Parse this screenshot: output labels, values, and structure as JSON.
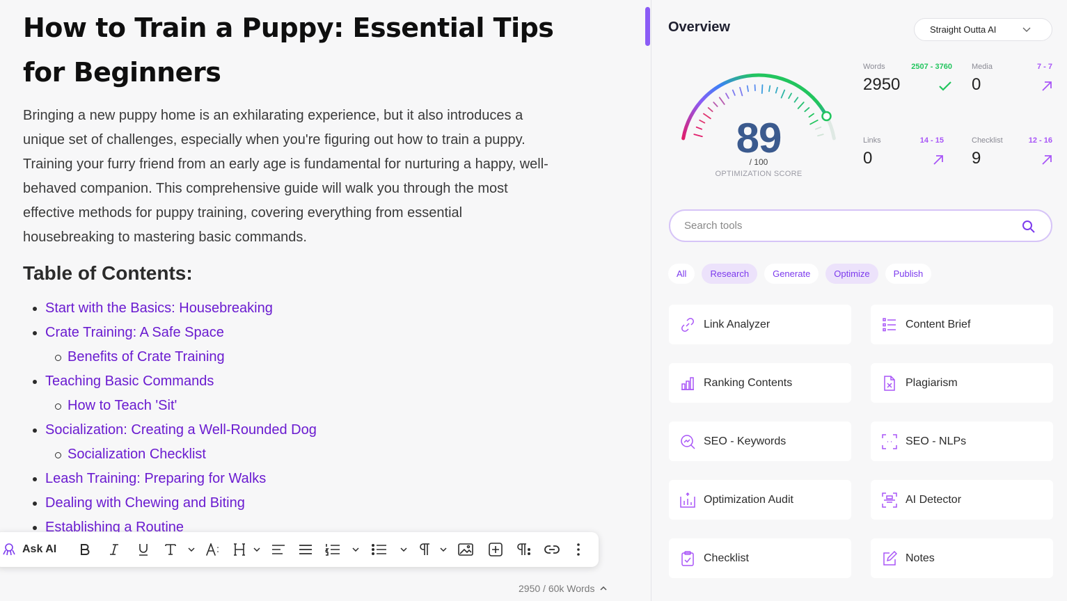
{
  "document": {
    "title": "How to Train a Puppy: Essential Tips for Beginners",
    "intro": "Bringing a new puppy home is an exhilarating experience, but it also introduces a unique set of challenges, especially when you're figuring out how to train a puppy. Training your furry friend from an early age is fundamental for nurturing a happy, well-behaved companion. This comprehensive guide will walk you through the most effective methods for puppy training, covering everything from essential housebreaking to mastering basic commands.",
    "toc_heading": "Table of Contents:",
    "toc": [
      {
        "label": "Start with the Basics: Housebreaking",
        "level": 1
      },
      {
        "label": "Crate Training: A Safe Space",
        "level": 1
      },
      {
        "label": "Benefits of Crate Training",
        "level": 2
      },
      {
        "label": "Teaching Basic Commands",
        "level": 1
      },
      {
        "label": "How to Teach 'Sit'",
        "level": 2
      },
      {
        "label": "Socialization: Creating a Well-Rounded Dog",
        "level": 1
      },
      {
        "label": "Socialization Checklist",
        "level": 2
      },
      {
        "label": "Leash Training: Preparing for Walks",
        "level": 1
      },
      {
        "label": "Dealing with Chewing and Biting",
        "level": 1
      },
      {
        "label": "Establishing a Routine",
        "level": 1
      }
    ],
    "link_color": "#6a1bd0"
  },
  "toolbar": {
    "ask_ai_label": "Ask AI",
    "icons": [
      "octopus-icon",
      "bold-icon",
      "italic-icon",
      "underline-icon",
      "text-style-icon",
      "font-size-icon",
      "heading-icon",
      "align-left-icon",
      "justify-icon",
      "ordered-list-icon",
      "bullet-list-icon",
      "paragraph-icon",
      "image-icon",
      "add-block-icon",
      "show-formatting-icon",
      "link-icon",
      "more-icon"
    ]
  },
  "word_count": "2950 / 60k Words",
  "overview": {
    "title": "Overview",
    "mode_select": "Straight Outta AI",
    "score": "89",
    "score_max": "/ 100",
    "score_label": "OPTIMIZATION SCORE",
    "score_fraction": 0.89,
    "stats": {
      "words": {
        "name": "Words",
        "range": "2507 - 3760",
        "value": "2950",
        "status": "check-icon"
      },
      "media": {
        "name": "Media",
        "range": "7 - 7",
        "value": "0",
        "status": "arrow-up-right-icon"
      },
      "links": {
        "name": "Links",
        "range": "14 - 15",
        "value": "0",
        "status": "arrow-up-right-icon"
      },
      "checklist": {
        "name": "Checklist",
        "range": "12 - 16",
        "value": "9",
        "status": "arrow-up-right-icon"
      }
    },
    "colors": {
      "ok": "#22c55e",
      "needs_work": "#a855f7",
      "accent": "#7c3aed"
    }
  },
  "search": {
    "placeholder": "Search tools"
  },
  "filters": [
    {
      "label": "All",
      "active": false
    },
    {
      "label": "Research",
      "active": true
    },
    {
      "label": "Generate",
      "active": false
    },
    {
      "label": "Optimize",
      "active": true
    },
    {
      "label": "Publish",
      "active": false
    }
  ],
  "tools": [
    {
      "label": "Link Analyzer",
      "icon": "link-icon"
    },
    {
      "label": "Content Brief",
      "icon": "list-icon"
    },
    {
      "label": "Ranking Contents",
      "icon": "bar-chart-icon"
    },
    {
      "label": "Plagiarism",
      "icon": "document-x-icon"
    },
    {
      "label": "SEO - Keywords",
      "icon": "magnifier-chart-icon"
    },
    {
      "label": "SEO - NLPs",
      "icon": "scan-icon"
    },
    {
      "label": "Optimization Audit",
      "icon": "audit-chart-icon"
    },
    {
      "label": "AI Detector",
      "icon": "ai-scan-icon"
    },
    {
      "label": "Checklist",
      "icon": "clipboard-check-icon"
    },
    {
      "label": "Notes",
      "icon": "edit-note-icon"
    }
  ]
}
